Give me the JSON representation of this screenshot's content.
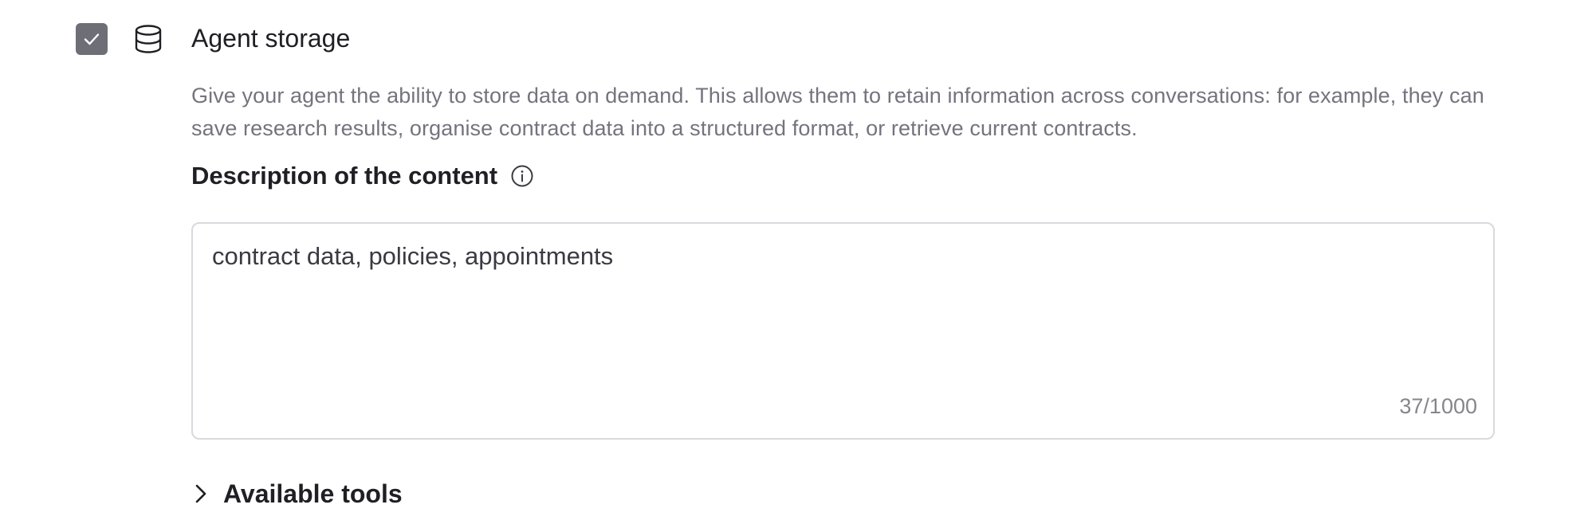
{
  "section": {
    "checked": true,
    "title": "Agent storage",
    "icon": "database-icon",
    "description": "Give your agent the ability to store data on demand. This allows them to retain information across conversations: for example, they can save research results, organise contract data into a structured format, or retrieve current contracts."
  },
  "content_field": {
    "label": "Description of the content",
    "info_icon": "info-icon",
    "value": "contract data, policies, appointments",
    "counter": "37/1000"
  },
  "tools": {
    "label": "Available tools",
    "icon": "chevron-right-icon",
    "expanded": false
  },
  "colors": {
    "checkbox_bg": "#6e6e77",
    "text_primary": "#1f1f24",
    "text_secondary": "#74747e",
    "border": "#d9d9de"
  }
}
